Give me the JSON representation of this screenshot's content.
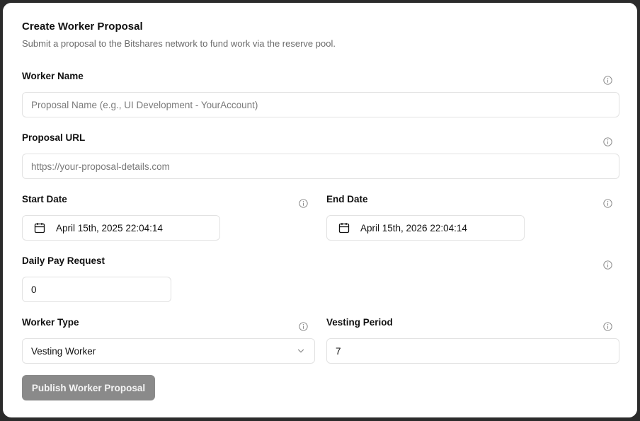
{
  "form": {
    "title": "Create Worker Proposal",
    "subtitle": "Submit a proposal to the Bitshares network to fund work via the reserve pool.",
    "worker_name": {
      "label": "Worker Name",
      "placeholder": "Proposal Name (e.g., UI Development - YourAccount)",
      "value": ""
    },
    "proposal_url": {
      "label": "Proposal URL",
      "placeholder": "https://your-proposal-details.com",
      "value": ""
    },
    "start_date": {
      "label": "Start Date",
      "value": "April 15th, 2025 22:04:14"
    },
    "end_date": {
      "label": "End Date",
      "value": "April 15th, 2026 22:04:14"
    },
    "daily_pay": {
      "label": "Daily Pay Request",
      "value": "0"
    },
    "worker_type": {
      "label": "Worker Type",
      "selected": "Vesting Worker"
    },
    "vesting_period": {
      "label": "Vesting Period",
      "value": "7"
    },
    "publish_label": "Publish Worker Proposal"
  },
  "colors": {
    "background": "#2b2b2b",
    "card": "#ffffff",
    "border": "#e2e2e2",
    "button_disabled": "#8a8a8a",
    "muted_text": "#6b6b6b"
  },
  "icons": {
    "info": "info-circle-icon",
    "calendar": "calendar-icon",
    "chevron": "chevron-down-icon"
  }
}
